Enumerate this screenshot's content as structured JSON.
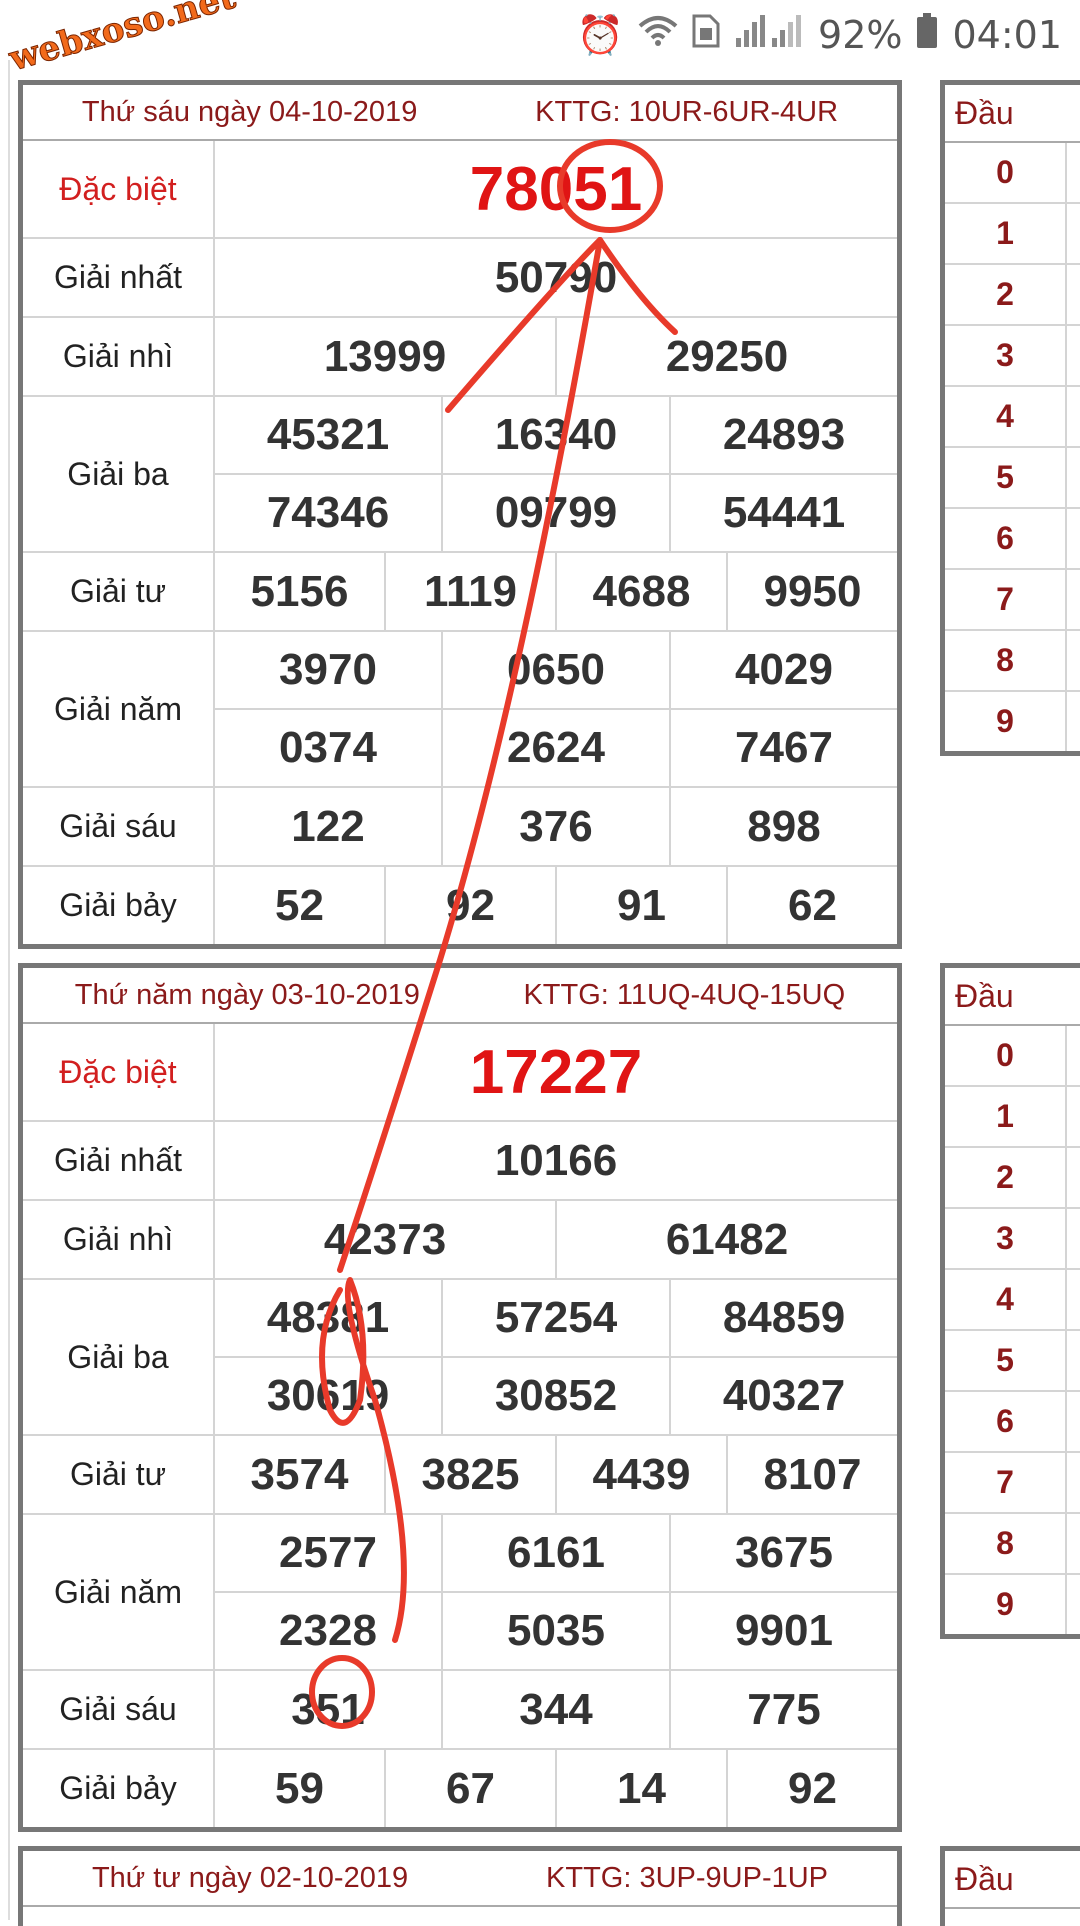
{
  "status": {
    "battery": "92%",
    "time": "04:01"
  },
  "logo": "webxoso.net",
  "tables": [
    {
      "date": "Thứ sáu ngày 04-10-2019",
      "kttg": "KTTG: 10UR-6UR-4UR",
      "rows": [
        {
          "label": "Đặc biệt",
          "special": true,
          "lines": [
            [
              "78051"
            ]
          ]
        },
        {
          "label": "Giải nhất",
          "lines": [
            [
              "50790"
            ]
          ]
        },
        {
          "label": "Giải nhì",
          "lines": [
            [
              "13999",
              "29250"
            ]
          ]
        },
        {
          "label": "Giải ba",
          "lines": [
            [
              "45321",
              "16340",
              "24893"
            ],
            [
              "74346",
              "09799",
              "54441"
            ]
          ]
        },
        {
          "label": "Giải tư",
          "lines": [
            [
              "5156",
              "1119",
              "4688",
              "9950"
            ]
          ]
        },
        {
          "label": "Giải năm",
          "lines": [
            [
              "3970",
              "0650",
              "4029"
            ],
            [
              "0374",
              "2624",
              "7467"
            ]
          ]
        },
        {
          "label": "Giải sáu",
          "lines": [
            [
              "122",
              "376",
              "898"
            ]
          ]
        },
        {
          "label": "Giải bảy",
          "lines": [
            [
              "52",
              "92",
              "91",
              "62"
            ]
          ]
        }
      ]
    },
    {
      "date": "Thứ năm ngày 03-10-2019",
      "kttg": "KTTG: 11UQ-4UQ-15UQ",
      "rows": [
        {
          "label": "Đặc biệt",
          "special": true,
          "lines": [
            [
              "17227"
            ]
          ]
        },
        {
          "label": "Giải nhất",
          "lines": [
            [
              "10166"
            ]
          ]
        },
        {
          "label": "Giải nhì",
          "lines": [
            [
              "42373",
              "61482"
            ]
          ]
        },
        {
          "label": "Giải ba",
          "lines": [
            [
              "48381",
              "57254",
              "84859"
            ],
            [
              "30619",
              "30852",
              "40327"
            ]
          ]
        },
        {
          "label": "Giải tư",
          "lines": [
            [
              "3574",
              "3825",
              "4439",
              "8107"
            ]
          ]
        },
        {
          "label": "Giải năm",
          "lines": [
            [
              "2577",
              "6161",
              "3675"
            ],
            [
              "2328",
              "5035",
              "9901"
            ]
          ]
        },
        {
          "label": "Giải sáu",
          "lines": [
            [
              "351",
              "344",
              "775"
            ]
          ]
        },
        {
          "label": "Giải bảy",
          "lines": [
            [
              "59",
              "67",
              "14",
              "92"
            ]
          ]
        }
      ]
    },
    {
      "date": "Thứ tư ngày 02-10-2019",
      "kttg": "KTTG: 3UP-9UP-1UP",
      "rows": []
    }
  ],
  "side_tables": [
    {
      "head": "Đầu",
      "digits": [
        "0",
        "1",
        "2",
        "3",
        "4",
        "5",
        "6",
        "7",
        "8",
        "9"
      ]
    },
    {
      "head": "Đầu",
      "digits": [
        "0",
        "1",
        "2",
        "3",
        "4",
        "5",
        "6",
        "7",
        "8",
        "9"
      ]
    },
    {
      "head": "Đầu",
      "digits": []
    }
  ]
}
